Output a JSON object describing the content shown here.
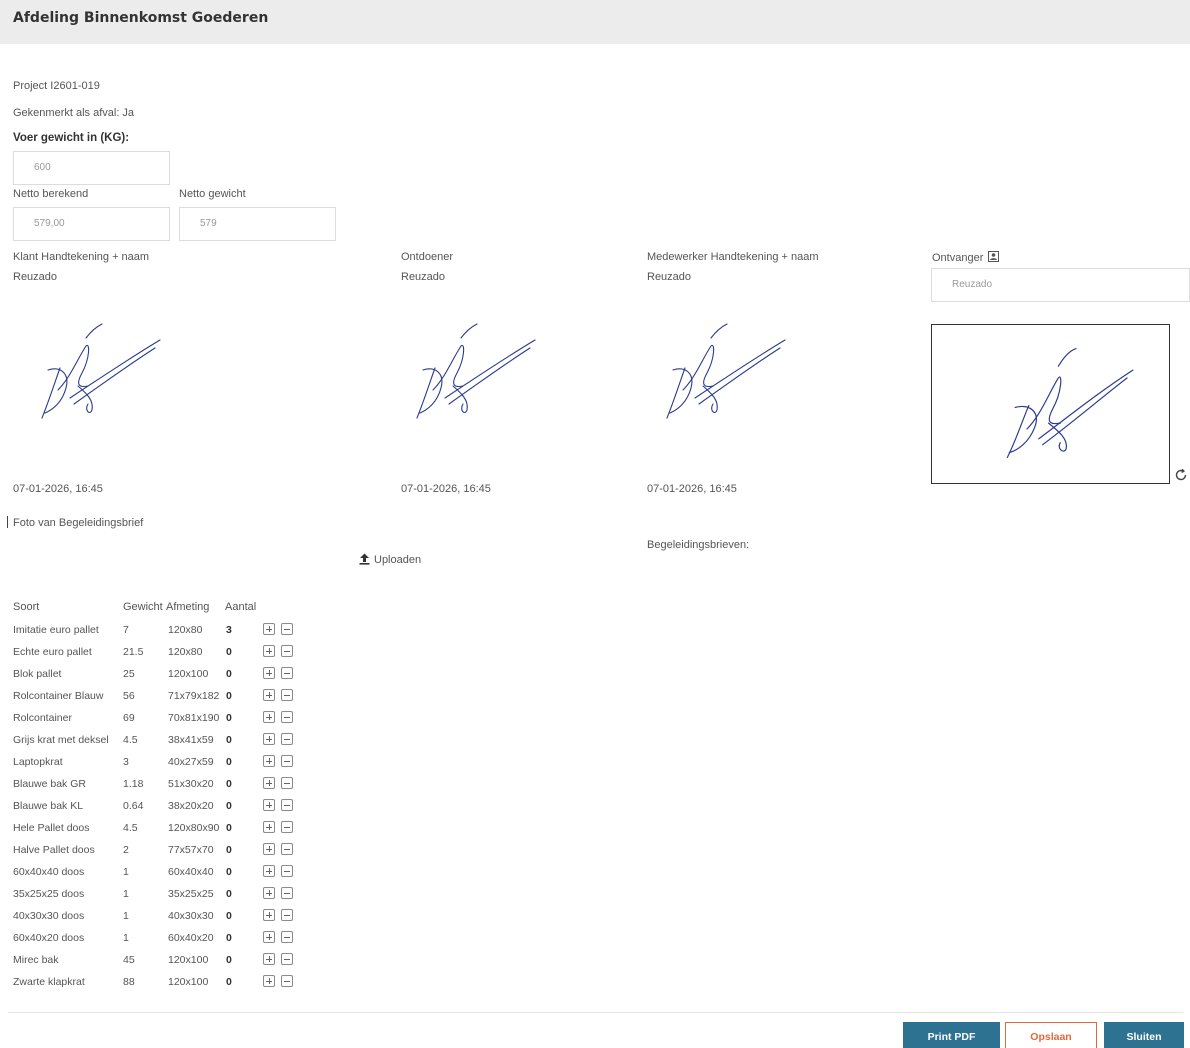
{
  "header": {
    "title": "Afdeling Binnenkomst Goederen"
  },
  "info": {
    "project": "Project I2601-019",
    "waste": "Gekenmerkt als afval: Ja",
    "weight_label": "Voer gewicht in (KG):"
  },
  "weight": {
    "value": "600"
  },
  "netto": {
    "calc_label": "Netto berekend",
    "calc_value": "579,00",
    "weight_label": "Netto gewicht",
    "weight_value": "579"
  },
  "signatures": {
    "klant": {
      "label": "Klant Handtekening + naam",
      "name": "Reuzado",
      "date": "07-01-2026, 16:45"
    },
    "ontdoener": {
      "label": "Ontdoener",
      "name": "Reuzado",
      "date": "07-01-2026, 16:45"
    },
    "medewerker": {
      "label": "Medewerker Handtekening + naam",
      "name": "Reuzado",
      "date": "07-01-2026, 16:45"
    },
    "ontvanger": {
      "label": "Ontvanger",
      "placeholder": "Reuzado"
    }
  },
  "upload": {
    "photo_label": "Foto van Begeleidingsbrief",
    "button": "Uploaden",
    "letters_label": "Begeleidingsbrieven:"
  },
  "table": {
    "headers": {
      "soort": "Soort",
      "gewicht": "Gewicht",
      "afmeting": "Afmeting",
      "aantal": "Aantal"
    },
    "rows": [
      {
        "soort": "Imitatie euro pallet",
        "gewicht": "7",
        "afmeting": "120x80",
        "aantal": "3"
      },
      {
        "soort": "Echte euro pallet",
        "gewicht": "21.5",
        "afmeting": "120x80",
        "aantal": "0"
      },
      {
        "soort": "Blok pallet",
        "gewicht": "25",
        "afmeting": "120x100",
        "aantal": "0"
      },
      {
        "soort": "Rolcontainer Blauw",
        "gewicht": "56",
        "afmeting": "71x79x182",
        "aantal": "0"
      },
      {
        "soort": "Rolcontainer",
        "gewicht": "69",
        "afmeting": "70x81x190",
        "aantal": "0"
      },
      {
        "soort": "Grijs krat met deksel",
        "gewicht": "4.5",
        "afmeting": "38x41x59",
        "aantal": "0"
      },
      {
        "soort": "Laptopkrat",
        "gewicht": "3",
        "afmeting": "40x27x59",
        "aantal": "0"
      },
      {
        "soort": "Blauwe bak GR",
        "gewicht": "1.18",
        "afmeting": "51x30x20",
        "aantal": "0"
      },
      {
        "soort": "Blauwe bak KL",
        "gewicht": "0.64",
        "afmeting": "38x20x20",
        "aantal": "0"
      },
      {
        "soort": "Hele Pallet doos",
        "gewicht": "4.5",
        "afmeting": "120x80x90",
        "aantal": "0"
      },
      {
        "soort": "Halve Pallet doos",
        "gewicht": "2",
        "afmeting": "77x57x70",
        "aantal": "0"
      },
      {
        "soort": "60x40x40 doos",
        "gewicht": "1",
        "afmeting": "60x40x40",
        "aantal": "0"
      },
      {
        "soort": "35x25x25 doos",
        "gewicht": "1",
        "afmeting": "35x25x25",
        "aantal": "0"
      },
      {
        "soort": "40x30x30 doos",
        "gewicht": "1",
        "afmeting": "40x30x30",
        "aantal": "0"
      },
      {
        "soort": "60x40x20 doos",
        "gewicht": "1",
        "afmeting": "60x40x20",
        "aantal": "0"
      },
      {
        "soort": "Mirec bak",
        "gewicht": "45",
        "afmeting": "120x100",
        "aantal": "0"
      },
      {
        "soort": "Zwarte klapkrat",
        "gewicht": "88",
        "afmeting": "120x100",
        "aantal": "0"
      }
    ]
  },
  "footer": {
    "print": "Print PDF",
    "save": "Opslaan",
    "close": "Sluiten"
  },
  "colors": {
    "primary": "#2d7290",
    "save": "#e0683e",
    "header_bg": "#ececec",
    "signature_ink": "#2b3a8c"
  },
  "icons": {
    "ontvanger": "id-card-icon",
    "refresh": "refresh-icon",
    "upload": "upload-icon",
    "plus": "plus-square-icon",
    "minus": "minus-square-icon"
  }
}
